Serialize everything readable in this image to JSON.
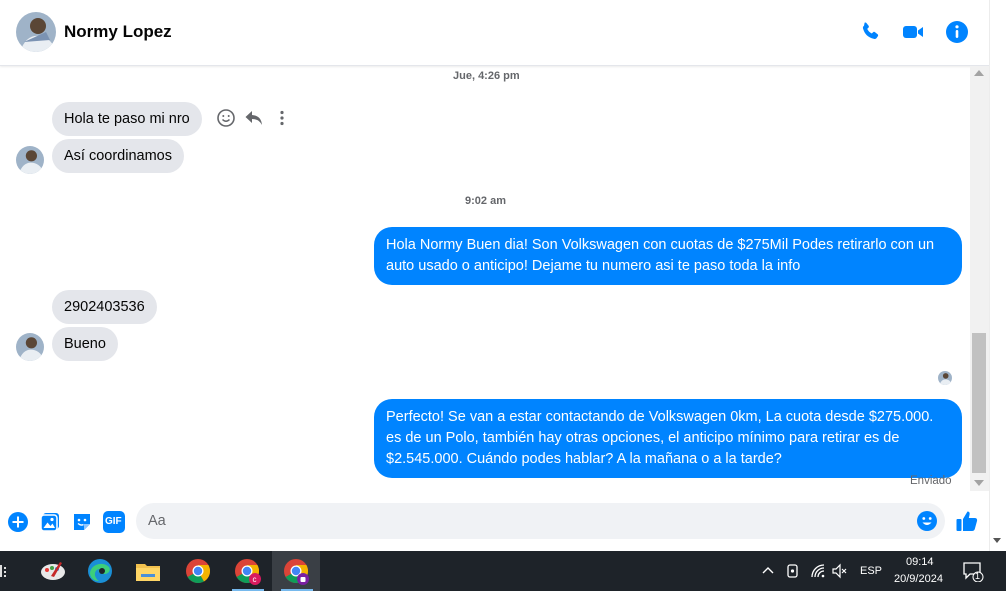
{
  "header": {
    "contact_name": "Normy Lopez",
    "icons": [
      "phone-icon",
      "video-icon",
      "info-icon"
    ]
  },
  "conversation": {
    "timestamps": [
      "Jue, 4:26 pm",
      "9:02 am"
    ],
    "messages": [
      {
        "from": "contact",
        "text": "Hola te paso mi nro"
      },
      {
        "from": "contact",
        "text": "Así coordinamos"
      },
      {
        "from": "me",
        "text": "Hola Normy Buen dia! Son Volkswagen con cuotas de $275Mil Podes retirarlo con un auto usado o anticipo! Dejame tu numero asi te paso toda la info"
      },
      {
        "from": "contact",
        "text": "2902403536"
      },
      {
        "from": "contact",
        "text": "Bueno"
      },
      {
        "from": "me",
        "text": "Perfecto!  Se van a estar contactando de Volkswagen 0km, La cuota desde $275.000. es de un Polo, también hay otras opciones, el anticipo mínimo para retirar es de $2.545.000. Cuándo podes hablar? A la mañana o a la tarde?"
      }
    ],
    "status": "Enviado"
  },
  "composer": {
    "placeholder": "Aa",
    "icons": [
      "plus-icon",
      "gallery-icon",
      "sticker-icon",
      "gif-icon",
      "emoji-icon",
      "like-icon"
    ],
    "gif_label": "GIF"
  },
  "taskbar": {
    "apps": [
      "paint-icon",
      "edge-icon",
      "file-explorer-icon",
      "chrome-icon",
      "chrome-profile-c-icon",
      "chrome-profile-active-icon"
    ],
    "language": "ESP",
    "time": "09:14",
    "date": "20/9/2024",
    "notification_count": "1"
  },
  "colors": {
    "accent": "#0084ff",
    "incoming_bubble": "#e4e6eb",
    "taskbar": "#1e2329"
  }
}
